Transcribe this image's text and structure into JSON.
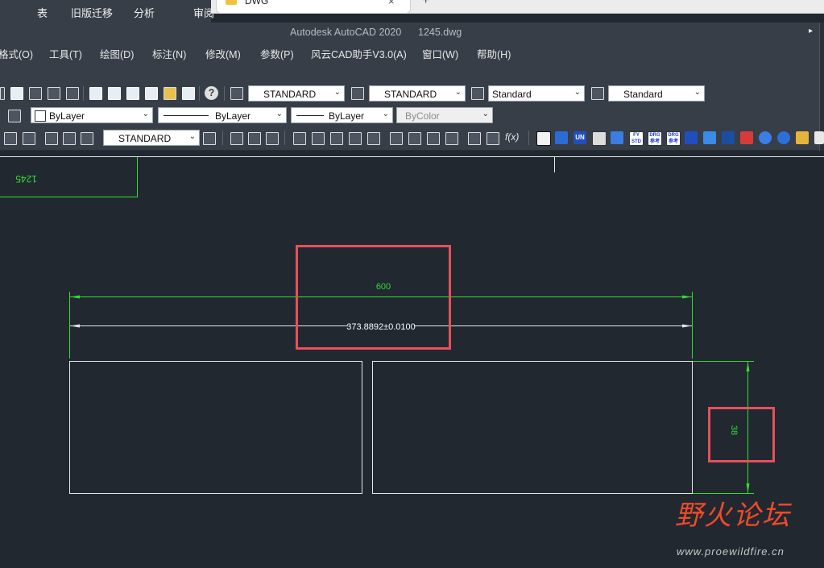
{
  "ribbon_tabs": [
    "表",
    "旧版迁移",
    "分析",
    "审阅"
  ],
  "browser": {
    "tab_title": "DWG",
    "close_symbol": "×",
    "new_tab_symbol": "+"
  },
  "window": {
    "app_title": "Autodesk AutoCAD 2020",
    "file_name": "1245.dwg",
    "expand_symbol": "▸"
  },
  "menu": [
    "格式(O)",
    "工具(T)",
    "绘图(D)",
    "标注(N)",
    "修改(M)",
    "参数(P)",
    "风云CAD助手V3.0(A)",
    "窗口(W)",
    "帮助(H)"
  ],
  "toolbar": {
    "text_style": "STANDARD",
    "dim_style": "STANDARD",
    "table_style": "Standard",
    "mleader_style": "Standard",
    "layer_color": "ByLayer",
    "linetype": "ByLayer",
    "lineweight": "ByLayer",
    "plot_style": "ByColor",
    "dim_style_2": "STANDARD",
    "help_symbol": "?",
    "fx_symbol": "f(x)",
    "dropdown_arrow": "⌄"
  },
  "tool_icons": [
    "FY STD",
    "DRG 参考",
    "DRG 参考",
    "UN"
  ],
  "drawing": {
    "title_block_text": "1245",
    "dim_top": "600",
    "dim_mid": "373.8892±0.0100",
    "dim_right": "38",
    "colors": {
      "dimension": "#33dd33",
      "geometry": "#e6e6e6",
      "highlight": "#e8505b",
      "background": "#212830"
    }
  },
  "watermark": {
    "brand": "野火论坛",
    "url": "www.proewildfire.cn"
  }
}
